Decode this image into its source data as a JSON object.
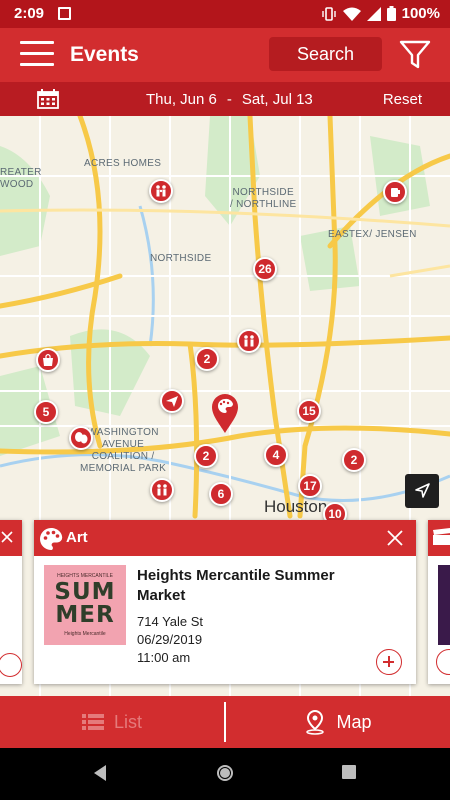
{
  "status_bar": {
    "time": "2:09",
    "battery": "100%"
  },
  "header": {
    "title": "Events",
    "search_label": "Search"
  },
  "date_bar": {
    "start": "Thu, Jun 6",
    "separator": "-",
    "end": "Sat, Jul 13",
    "reset_label": "Reset"
  },
  "map": {
    "labels": {
      "acres_homes": "ACRES HOMES",
      "northside_northline_1": "NORTHSIDE",
      "northside_northline_2": "/ NORTHLINE",
      "eastex": "EASTEX/ JENSEN",
      "northside": "NORTHSIDE",
      "greater_1": "REATER",
      "greater_2": "WOOD",
      "washington_1": "WASHINGTON",
      "washington_2": "AVENUE",
      "washington_3": "COALITION /",
      "washington_4": "MEMORIAL PARK",
      "houston": "Houston"
    },
    "cluster_counts": {
      "c26": "26",
      "c2a": "2",
      "c5": "5",
      "c15": "15",
      "c2b": "2",
      "c4": "4",
      "c2c": "2",
      "c6": "6",
      "c17": "17",
      "c10": "10"
    }
  },
  "event_card": {
    "category": "Art",
    "title": "Heights Mercantile Summer Market",
    "address": "714 Yale St",
    "date": "06/29/2019",
    "time": "11:00 am",
    "thumb_line1": "SUM",
    "thumb_line2": "MER",
    "thumb_top": "HEIGHTS MERCANTILE",
    "thumb_bottom": "Heights Mercantile"
  },
  "bottom_nav": {
    "list_label": "List",
    "map_label": "Map"
  },
  "colors": {
    "primary": "#d22d2f",
    "status_bar": "#b3151b",
    "date_bar": "#b81c22",
    "map_bg": "#f5f1e5",
    "highway": "#f7c948",
    "marker": "#cf2a2e"
  }
}
